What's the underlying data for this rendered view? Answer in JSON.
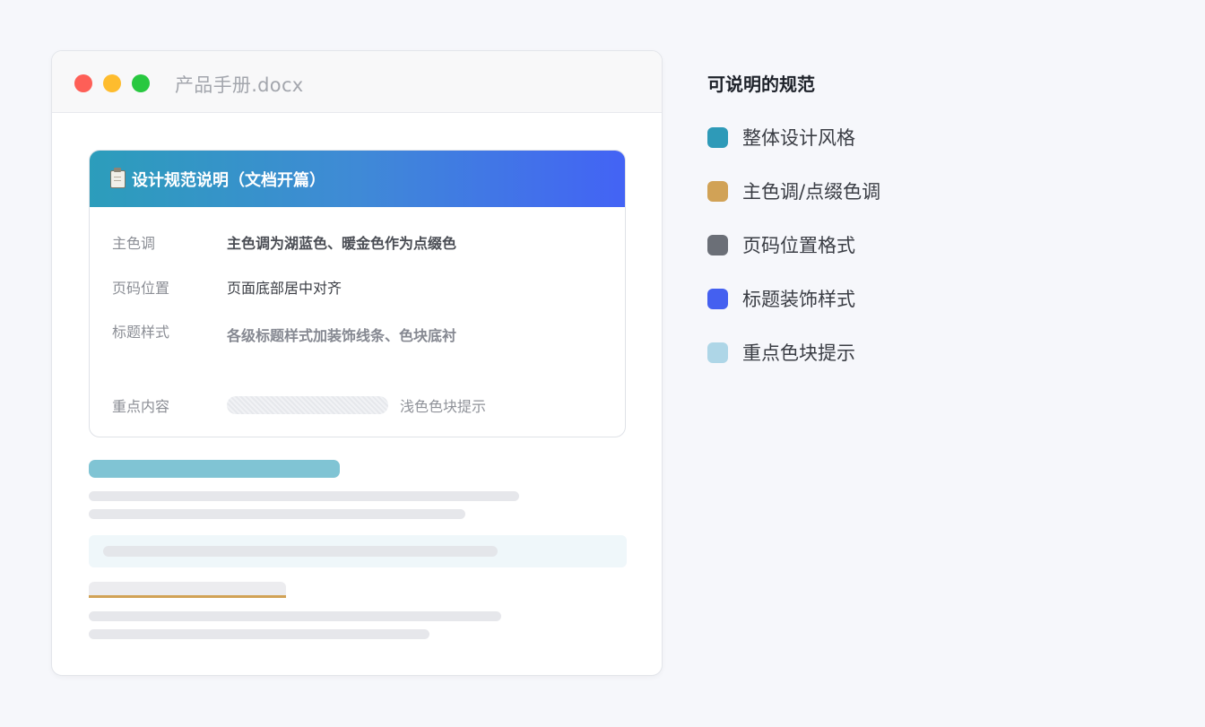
{
  "window": {
    "title": "产品手册.docx"
  },
  "card": {
    "title": "设计规范说明（文档开篇）",
    "rows": [
      {
        "label": "主色调",
        "value": "主色调为湖蓝色、暖金色作为点缀色"
      },
      {
        "label": "页码位置",
        "value": "页面底部居中对齐"
      },
      {
        "label": "标题样式",
        "value": "各级标题样式加装饰线条、色块底衬"
      },
      {
        "label": "重点内容",
        "value": "浅色色块提示"
      }
    ]
  },
  "legend": {
    "title": "可说明的规范",
    "items": [
      {
        "label": "整体设计风格",
        "color": "#2e9ab8"
      },
      {
        "label": "主色调/点缀色调",
        "color": "#d1a256"
      },
      {
        "label": "页码位置格式",
        "color": "#6b6f77"
      },
      {
        "label": "标题装饰样式",
        "color": "#4460f0"
      },
      {
        "label": "重点色块提示",
        "color": "#aed6e7"
      }
    ]
  }
}
